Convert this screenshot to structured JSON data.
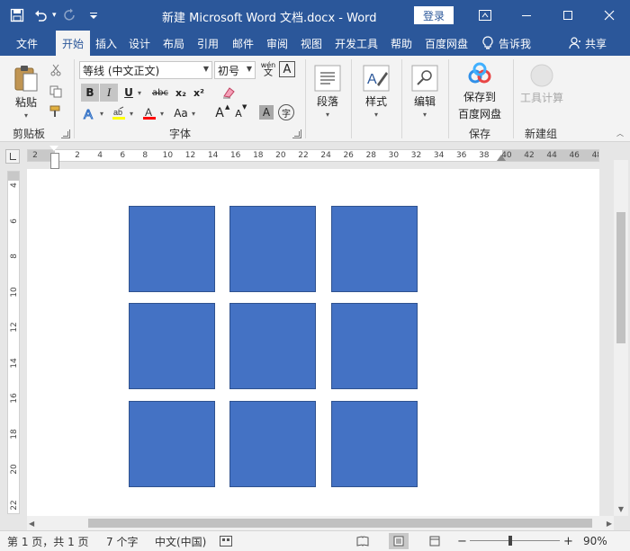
{
  "window": {
    "title": "新建 Microsoft Word 文档.docx  -  Word",
    "login_label": "登录"
  },
  "tabs": [
    {
      "label": "文件"
    },
    {
      "label": "开始",
      "active": true
    },
    {
      "label": "插入"
    },
    {
      "label": "设计"
    },
    {
      "label": "布局"
    },
    {
      "label": "引用"
    },
    {
      "label": "邮件"
    },
    {
      "label": "审阅"
    },
    {
      "label": "视图"
    },
    {
      "label": "开发工具"
    },
    {
      "label": "帮助"
    },
    {
      "label": "百度网盘"
    }
  ],
  "tell_me": "告诉我",
  "share": "共享",
  "ribbon": {
    "clipboard": {
      "paste_label": "粘贴",
      "group_label": "剪贴板"
    },
    "font": {
      "font_name": "等线 (中文正文)",
      "font_size": "初号",
      "group_label": "字体",
      "bold": "B",
      "italic": "I",
      "underline": "U",
      "strike": "abc",
      "subscript": "x₂",
      "superscript": "x²",
      "change_case": "Aa",
      "grow": "A",
      "shrink": "A",
      "phonetic": "wén",
      "phonetic_sub": "文",
      "char_border": "A",
      "char_shading": "A",
      "enclose": "字"
    },
    "paragraph": {
      "label": "段落"
    },
    "styles": {
      "label": "样式"
    },
    "editing": {
      "label": "编辑"
    },
    "save": {
      "line1": "保存到",
      "line2": "百度网盘",
      "group_label": "保存"
    },
    "newgroup": {
      "button_label": "工具计算",
      "group_label": "新建组"
    }
  },
  "ruler": {
    "h_ticks": [
      "2",
      "2",
      "4",
      "6",
      "8",
      "10",
      "12",
      "14",
      "16",
      "18",
      "20",
      "22",
      "24",
      "26",
      "28",
      "30",
      "32",
      "34",
      "36",
      "38",
      "40",
      "42",
      "44",
      "46",
      "48"
    ],
    "v_ticks": [
      "4",
      "6",
      "8",
      "10",
      "12",
      "14",
      "16",
      "18",
      "20",
      "22"
    ]
  },
  "document": {
    "shape_color": "#4472c4",
    "shape_rows": 3,
    "shape_cols": 3
  },
  "status": {
    "page": "第 1 页，共 1 页",
    "words": "7 个字",
    "language": "中文(中国)",
    "zoom": "90%",
    "zoom_minus": "−",
    "zoom_plus": "+"
  },
  "colors": {
    "brand": "#2b579a",
    "highlight": "#ffff00",
    "font_color": "#ff0000"
  }
}
